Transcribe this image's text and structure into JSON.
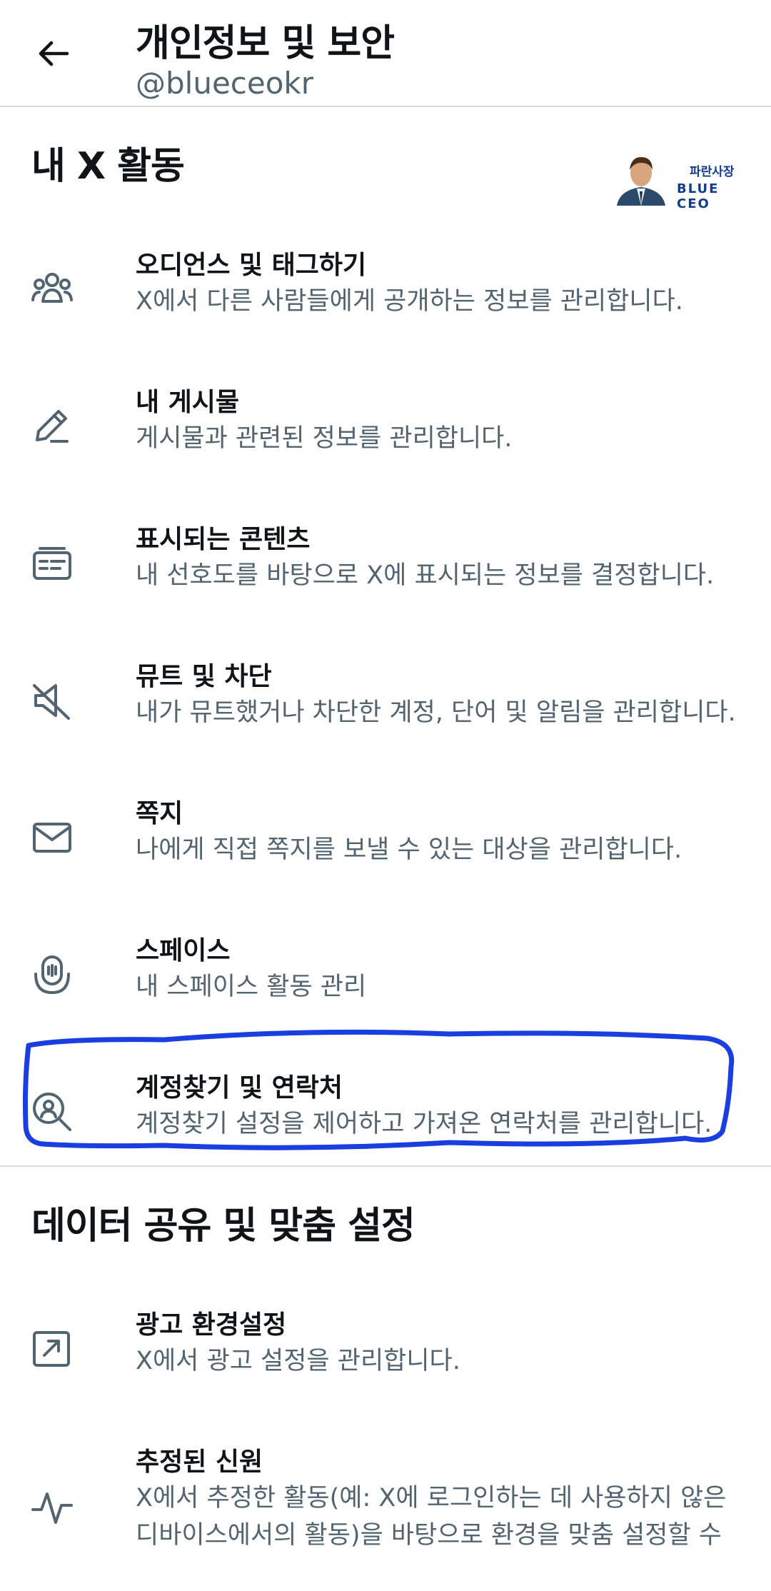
{
  "header": {
    "back_icon": "arrow-left-icon",
    "title": "개인정보 및 보안",
    "handle": "@blueceokr"
  },
  "watermark": {
    "line1": "파란사장",
    "line2": "BLUE CEO"
  },
  "section1": {
    "title": "내 X 활동",
    "items": [
      {
        "icon": "people-group-icon",
        "title": "오디언스 및 태그하기",
        "desc": "X에서 다른 사람들에게 공개하는 정보를 관리합니다."
      },
      {
        "icon": "pencil-icon",
        "title": "내 게시물",
        "desc": "게시물과 관련된 정보를 관리합니다."
      },
      {
        "icon": "content-card-icon",
        "title": "표시되는 콘텐츠",
        "desc": "내 선호도를 바탕으로 X에 표시되는 정보를 결정합니다."
      },
      {
        "icon": "mute-speaker-icon",
        "title": "뮤트 및 차단",
        "desc": "내가 뮤트했거나 차단한 계정, 단어 및 알림을 관리합니다."
      },
      {
        "icon": "envelope-icon",
        "title": "쪽지",
        "desc": "나에게 직접 쪽지를 보낼 수 있는 대상을 관리합니다."
      },
      {
        "icon": "spaces-mic-icon",
        "title": "스페이스",
        "desc": "내 스페이스 활동 관리"
      },
      {
        "icon": "person-search-icon",
        "title": "계정찾기 및 연락처",
        "desc": "계정찾기 설정을 제어하고 가져온 연락처를 관리합니다."
      }
    ]
  },
  "section2": {
    "title": "데이터 공유 및 맞춤 설정",
    "items": [
      {
        "icon": "external-arrow-icon",
        "title": "광고 환경설정",
        "desc": "X에서 광고 설정을 관리합니다."
      },
      {
        "icon": "activity-pulse-icon",
        "title": "추정된 신원",
        "desc": "X에서 추정한 활동(예: X에 로그인하는 데 사용하지 않은 디바이스에서의 활동)을 바탕으로 환경을 맞춤 설정할 수"
      }
    ]
  },
  "colors": {
    "text_primary": "#0f1419",
    "text_secondary": "#536471",
    "divider": "#d7dbdc",
    "highlight_stroke": "#1a3fe0"
  }
}
